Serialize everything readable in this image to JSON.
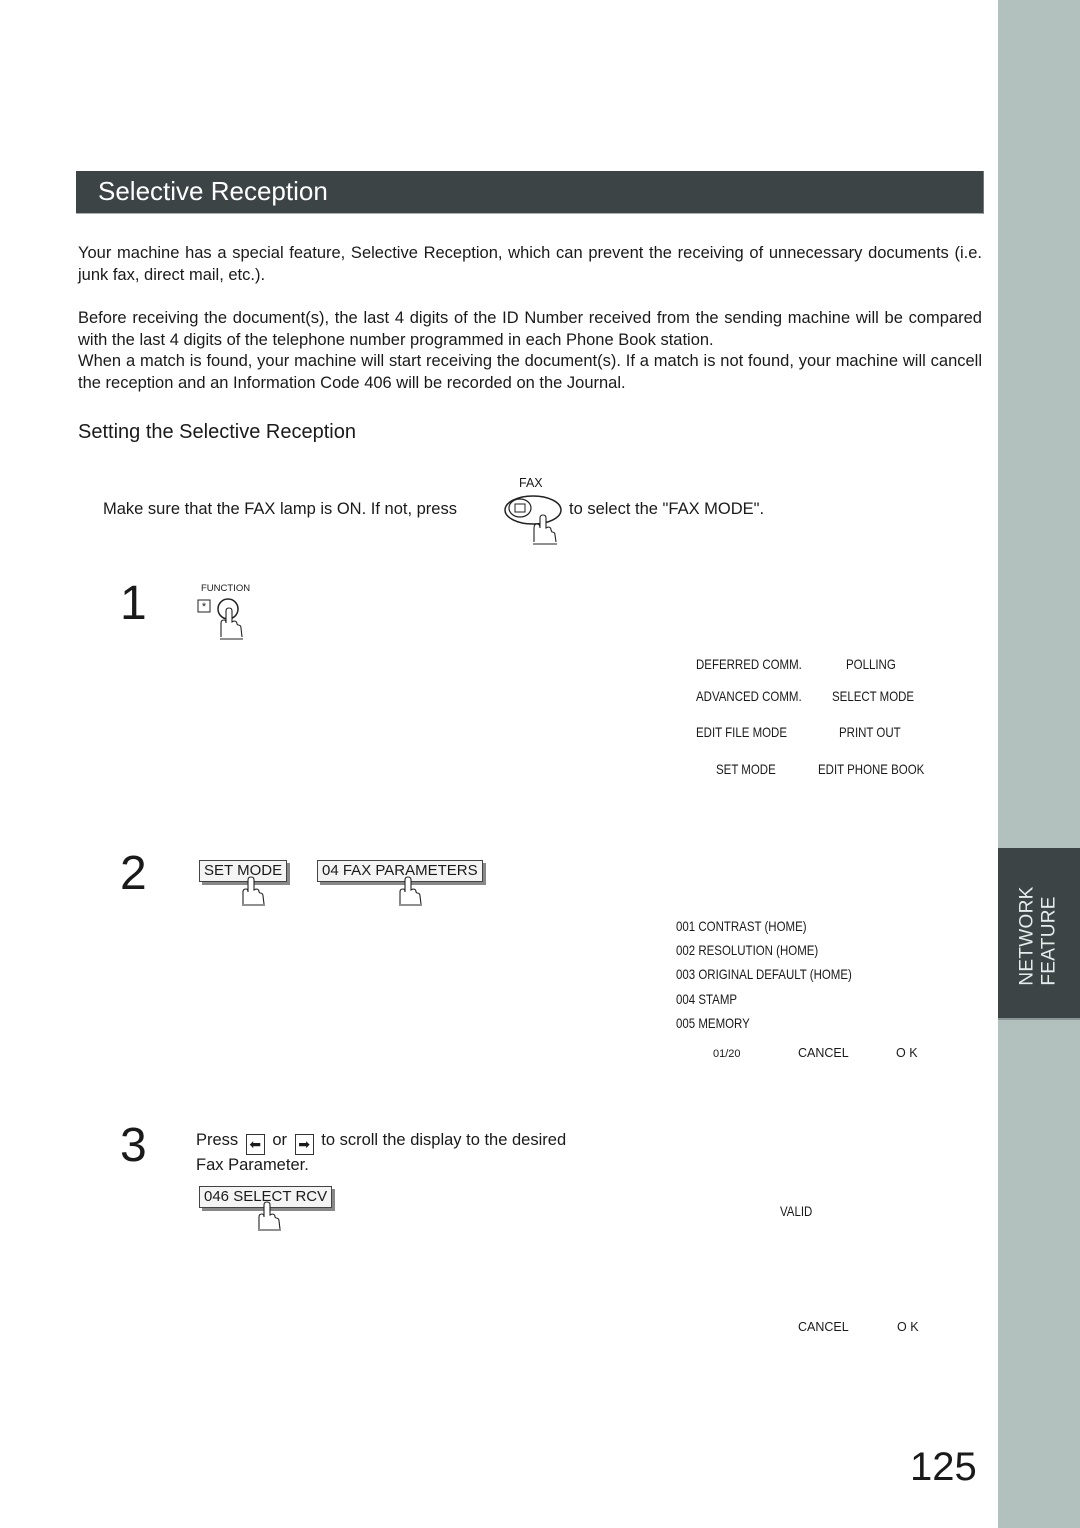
{
  "section": {
    "title": "Selective Reception",
    "intro_paragraph": "Your machine has a special feature, Selective Reception, which can prevent the receiving of unnecessary documents (i.e. junk fax, direct mail, etc.).",
    "detail_paragraph_1": "Before receiving the document(s), the last 4 digits of the ID Number received from the sending machine will be compared with the last 4 digits of the telephone number programmed in each Phone Book station.",
    "detail_paragraph_2": "When a match is found, your machine will start receiving the document(s). If a match is not found, your machine will cancell the reception and an Information Code 406 will be recorded on the Journal."
  },
  "subsection": {
    "title": "Setting the Selective Reception",
    "precondition_before": "Make sure that the FAX lamp is ON.  If not, press",
    "precondition_after": "to select the \"FAX MODE\".",
    "fax_key_label": "FAX"
  },
  "steps": [
    {
      "number": "1",
      "key_label": "FUNCTION",
      "display": {
        "menu": [
          [
            "DEFERRED COMM.",
            "POLLING"
          ],
          [
            "ADVANCED COMM.",
            "SELECT MODE"
          ],
          [
            "EDIT FILE MODE",
            "PRINT OUT"
          ],
          [
            "SET MODE",
            "EDIT PHONE BOOK"
          ]
        ]
      }
    },
    {
      "number": "2",
      "buttons": [
        "SET MODE",
        "04 FAX PARAMETERS"
      ],
      "display": {
        "list": [
          "001 CONTRAST (HOME)",
          "002 RESOLUTION (HOME)",
          "003 ORIGINAL DEFAULT (HOME)",
          "004 STAMP",
          "005 MEMORY"
        ],
        "page": "01/20",
        "cancel": "CANCEL",
        "ok": "O K"
      }
    },
    {
      "number": "3",
      "text_press": "Press",
      "text_or": "or",
      "text_rest": "to scroll the display to the desired",
      "text_line2": "Fax Parameter.",
      "button": "046 SELECT RCV",
      "display": {
        "value": "VALID",
        "cancel": "CANCEL",
        "ok": "O K"
      }
    }
  ],
  "side_tab": {
    "line1": "NETWORK",
    "line2": "FEATURE"
  },
  "page_number": "125"
}
